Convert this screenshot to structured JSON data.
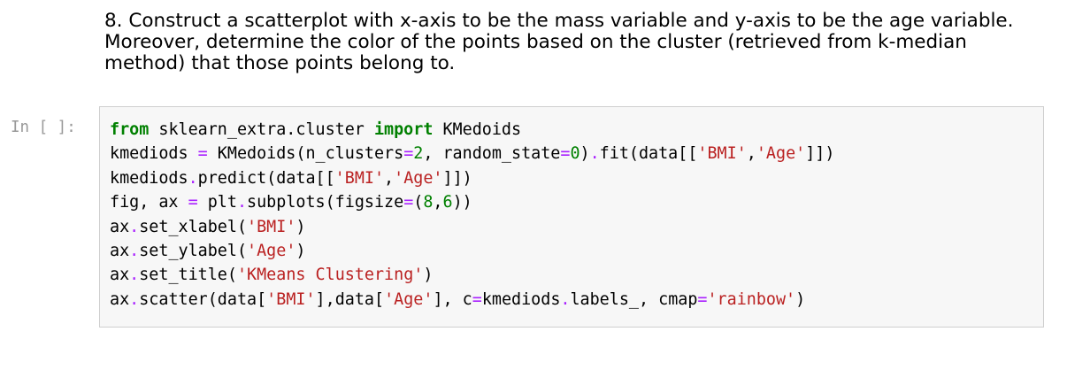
{
  "markdown": {
    "text": "8. Construct a scatterplot with x-axis to be the mass variable and y-axis to be the age variable. Moreover, determine the color of the points based on the cluster (retrieved from k-median method) that those points belong to."
  },
  "cell": {
    "prompt": "In [ ]:",
    "lines": [
      [
        {
          "t": "from",
          "c": "kw"
        },
        {
          "t": " sklearn_extra.cluster ",
          "c": ""
        },
        {
          "t": "import",
          "c": "kw"
        },
        {
          "t": " KMedoids",
          "c": ""
        }
      ],
      [
        {
          "t": "kmediods ",
          "c": ""
        },
        {
          "t": "=",
          "c": "op"
        },
        {
          "t": " KMedoids(n_clusters",
          "c": ""
        },
        {
          "t": "=",
          "c": "op"
        },
        {
          "t": "2",
          "c": "num"
        },
        {
          "t": ", random_state",
          "c": ""
        },
        {
          "t": "=",
          "c": "op"
        },
        {
          "t": "0",
          "c": "num"
        },
        {
          "t": ")",
          "c": ""
        },
        {
          "t": ".",
          "c": "op"
        },
        {
          "t": "fit(data[[",
          "c": ""
        },
        {
          "t": "'BMI'",
          "c": "str"
        },
        {
          "t": ",",
          "c": ""
        },
        {
          "t": "'Age'",
          "c": "str"
        },
        {
          "t": "]])",
          "c": ""
        }
      ],
      [
        {
          "t": "kmediods",
          "c": ""
        },
        {
          "t": ".",
          "c": "op"
        },
        {
          "t": "predict(data[[",
          "c": ""
        },
        {
          "t": "'BMI'",
          "c": "str"
        },
        {
          "t": ",",
          "c": ""
        },
        {
          "t": "'Age'",
          "c": "str"
        },
        {
          "t": "]])",
          "c": ""
        }
      ],
      [
        {
          "t": "fig, ax ",
          "c": ""
        },
        {
          "t": "=",
          "c": "op"
        },
        {
          "t": " plt",
          "c": ""
        },
        {
          "t": ".",
          "c": "op"
        },
        {
          "t": "subplots(figsize",
          "c": ""
        },
        {
          "t": "=",
          "c": "op"
        },
        {
          "t": "(",
          "c": ""
        },
        {
          "t": "8",
          "c": "num"
        },
        {
          "t": ",",
          "c": ""
        },
        {
          "t": "6",
          "c": "num"
        },
        {
          "t": "))",
          "c": ""
        }
      ],
      [
        {
          "t": "ax",
          "c": ""
        },
        {
          "t": ".",
          "c": "op"
        },
        {
          "t": "set_xlabel(",
          "c": ""
        },
        {
          "t": "'BMI'",
          "c": "str"
        },
        {
          "t": ")",
          "c": ""
        }
      ],
      [
        {
          "t": "ax",
          "c": ""
        },
        {
          "t": ".",
          "c": "op"
        },
        {
          "t": "set_ylabel(",
          "c": ""
        },
        {
          "t": "'Age'",
          "c": "str"
        },
        {
          "t": ")",
          "c": ""
        }
      ],
      [
        {
          "t": "ax",
          "c": ""
        },
        {
          "t": ".",
          "c": "op"
        },
        {
          "t": "set_title(",
          "c": ""
        },
        {
          "t": "'KMeans Clustering'",
          "c": "str"
        },
        {
          "t": ")",
          "c": ""
        }
      ],
      [
        {
          "t": "ax",
          "c": ""
        },
        {
          "t": ".",
          "c": "op"
        },
        {
          "t": "scatter(data[",
          "c": ""
        },
        {
          "t": "'BMI'",
          "c": "str"
        },
        {
          "t": "],data[",
          "c": ""
        },
        {
          "t": "'Age'",
          "c": "str"
        },
        {
          "t": "], c",
          "c": ""
        },
        {
          "t": "=",
          "c": "op"
        },
        {
          "t": "kmediods",
          "c": ""
        },
        {
          "t": ".",
          "c": "op"
        },
        {
          "t": "labels_, cmap",
          "c": ""
        },
        {
          "t": "=",
          "c": "op"
        },
        {
          "t": "'rainbow'",
          "c": "str"
        },
        {
          "t": ")",
          "c": ""
        }
      ]
    ]
  }
}
